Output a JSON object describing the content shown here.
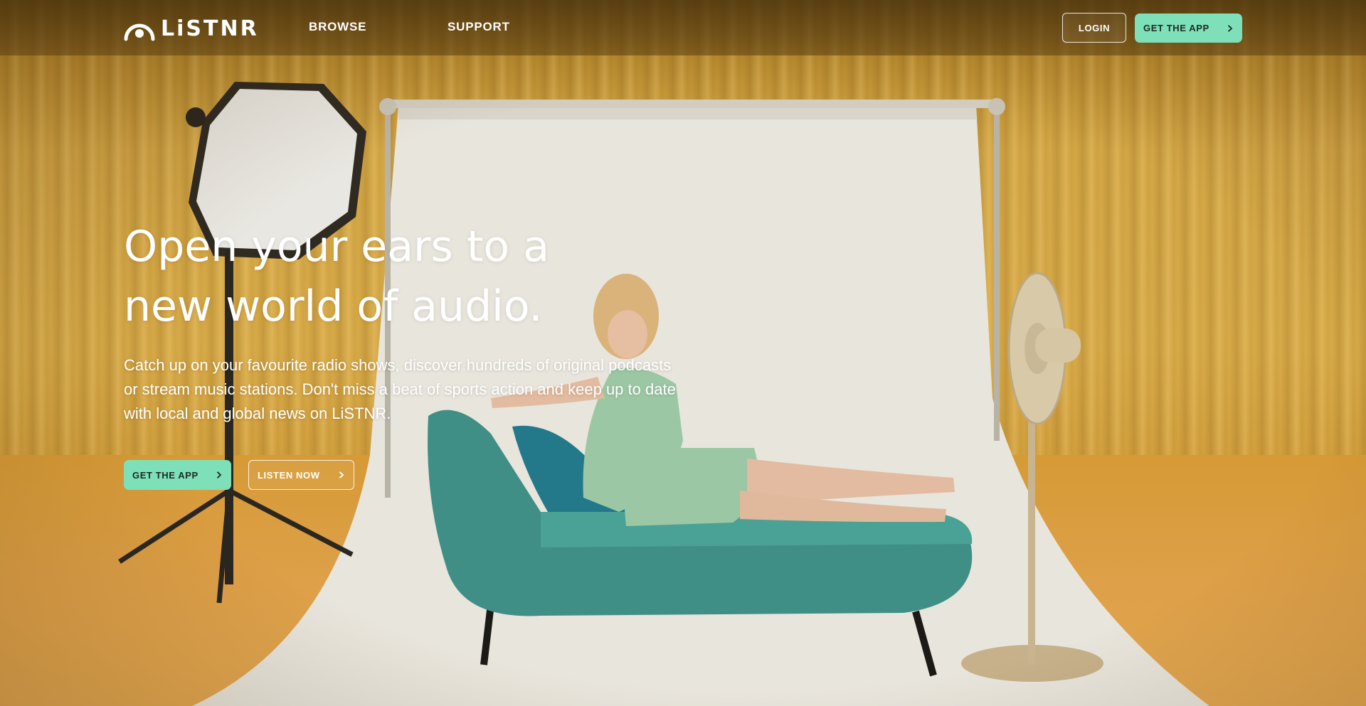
{
  "brand": {
    "name": "LiSTNR"
  },
  "nav": {
    "links": [
      {
        "label": "BROWSE"
      },
      {
        "label": "SUPPORT"
      }
    ],
    "login_label": "LOGIN",
    "get_app_label": "GET THE APP"
  },
  "hero": {
    "title": "Open your ears to a new world of audio.",
    "subtitle": "Catch up on your favourite radio shows, discover hundreds of original podcasts or stream music stations. Don't miss a beat of sports action and keep up to date with local and global news on LiSTNR.",
    "get_app_label": "GET THE APP",
    "listen_now_label": "LISTEN NOW"
  },
  "icons": {
    "logo": "listnr-logo-mark",
    "button_arrow": "chevron-right-icon"
  },
  "colors": {
    "accent": "#7ee0b8",
    "accent_text": "#1c2a25",
    "curtain": "#d3a646",
    "floor": "#dea048",
    "backdrop": "#e8e5dc",
    "sofa": "#3f8f86",
    "dress": "#9cc7a4"
  }
}
